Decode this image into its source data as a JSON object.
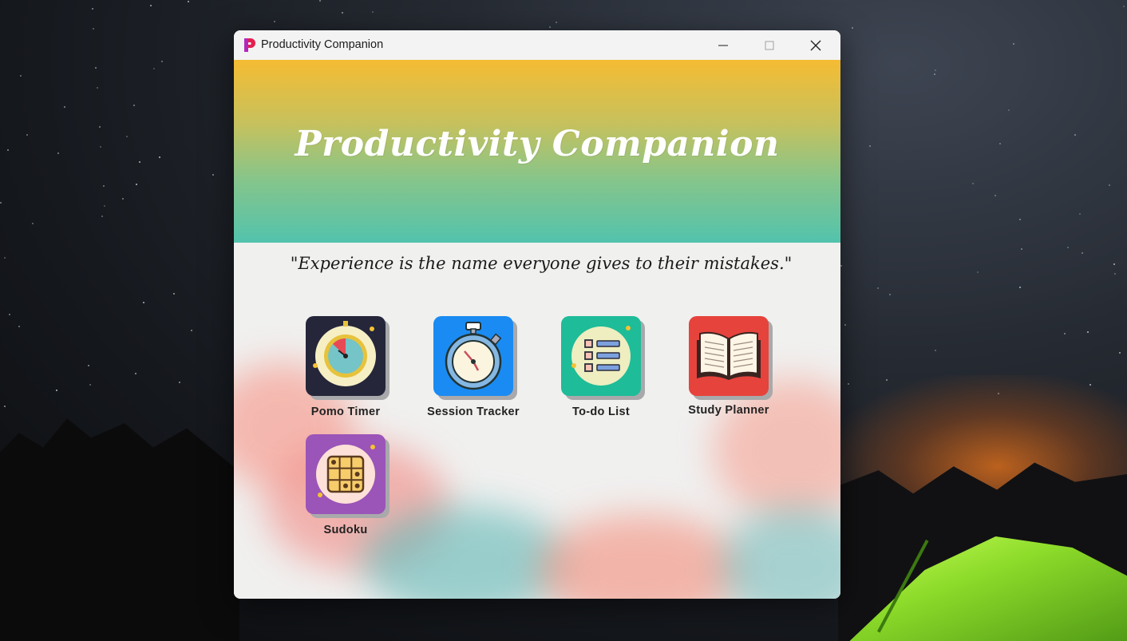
{
  "window": {
    "title": "Productivity Companion",
    "controls": [
      "minimize",
      "maximize",
      "close"
    ]
  },
  "header": {
    "title": "Productivity Companion",
    "gradient": [
      "#f5bc33",
      "#52c3ad"
    ]
  },
  "quote": "\"Experience is the name everyone gives to their mistakes.\"",
  "apps": [
    {
      "label": "Pomo Timer",
      "icon": "pomodoro-timer-icon",
      "color": "#25263a"
    },
    {
      "label": "Session Tracker",
      "icon": "stopwatch-icon",
      "color": "#1a8bf2"
    },
    {
      "label": "To-do List",
      "icon": "checklist-icon",
      "color": "#1ebc98"
    },
    {
      "label": "Study Planner",
      "icon": "open-book-icon",
      "color": "#e6433c"
    },
    {
      "label": "Sudoku",
      "icon": "sudoku-grid-icon",
      "color": "#9b54b8"
    }
  ]
}
